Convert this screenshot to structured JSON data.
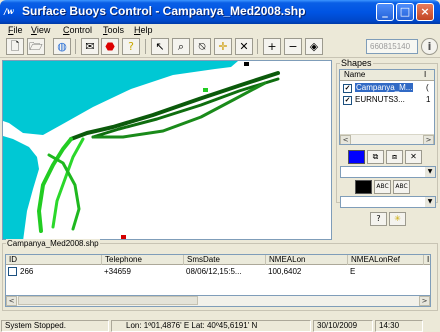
{
  "window": {
    "app_icon_text": "/w",
    "title": "Surface Buoys Control - Campanya_Med2008.shp",
    "minimize": "_",
    "maximize": "□",
    "close": "×"
  },
  "menu": [
    "File",
    "View",
    "Control",
    "Tools",
    "Help"
  ],
  "toolbar": {
    "icons": [
      "open-folder-icon",
      "globe-icon",
      "email-icon",
      "stop-icon",
      "help-icon",
      "pointer-icon",
      "zoom-in-icon",
      "zoom-out-icon",
      "pan-icon",
      "crosshair-icon",
      "distance-icon",
      "plus-icon",
      "minus-icon",
      "diamond-icon"
    ],
    "phone_value": "660815140",
    "info_glyph": "i"
  },
  "shapes_panel": {
    "title": "Shapes",
    "col_name": "Name",
    "col_h": "I",
    "layers": [
      {
        "name": "Campanya_M...",
        "extra": "(",
        "checked": true
      },
      {
        "name": "EURNUTS3...",
        "extra": "1",
        "checked": true
      }
    ],
    "fill_color": "#0000ff",
    "line_color": "#000000",
    "abc_label_1": "ABC",
    "abc_label_2": "ABC"
  },
  "table": {
    "title": "Campanya_Med2008.shp",
    "columns": [
      "ID",
      "Telephone",
      "SmsDate",
      "NMEALon",
      "NMEALonRef",
      "I"
    ],
    "rows": [
      {
        "id": "266",
        "telephone": "+34659",
        "smsdate": "08/06/12,15:5...",
        "nmealon": "100,6402",
        "nmealonref": "E"
      }
    ]
  },
  "status": {
    "state": "System Stopped.",
    "coords": "Lon: 1º01,4876' E Lat: 40º45,6191' N",
    "date": "30/10/2009",
    "time": "14:30"
  },
  "colors": {
    "sea": "#ffffff",
    "land": "#00c8d4",
    "track_dark": "#0b5a0b",
    "track_light": "#22cc22"
  }
}
